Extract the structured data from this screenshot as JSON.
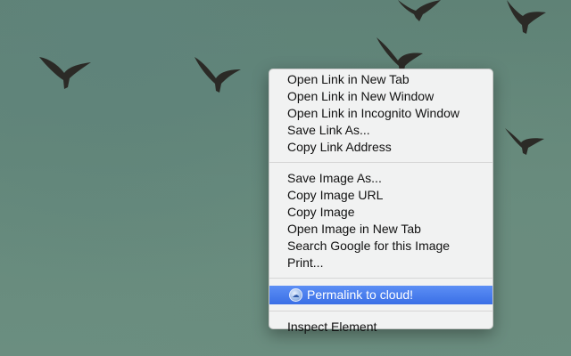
{
  "menu": {
    "group1": [
      {
        "label": "Open Link in New Tab"
      },
      {
        "label": "Open Link in New Window"
      },
      {
        "label": "Open Link in Incognito Window"
      },
      {
        "label": "Save Link As..."
      },
      {
        "label": "Copy Link Address"
      }
    ],
    "group2": [
      {
        "label": "Save Image As..."
      },
      {
        "label": "Copy Image URL"
      },
      {
        "label": "Copy Image"
      },
      {
        "label": "Open Image in New Tab"
      },
      {
        "label": "Search Google for this Image"
      },
      {
        "label": "Print..."
      }
    ],
    "highlighted": {
      "label": "Permalink to cloud!",
      "icon": "cloud-extension-icon"
    },
    "group3": [
      {
        "label": "Inspect Element"
      }
    ]
  },
  "colors": {
    "wallpaper": "#64877a",
    "menu_background": "#f6f6f6",
    "highlight": "#3a6fe6",
    "bird": "#2b2a26"
  }
}
